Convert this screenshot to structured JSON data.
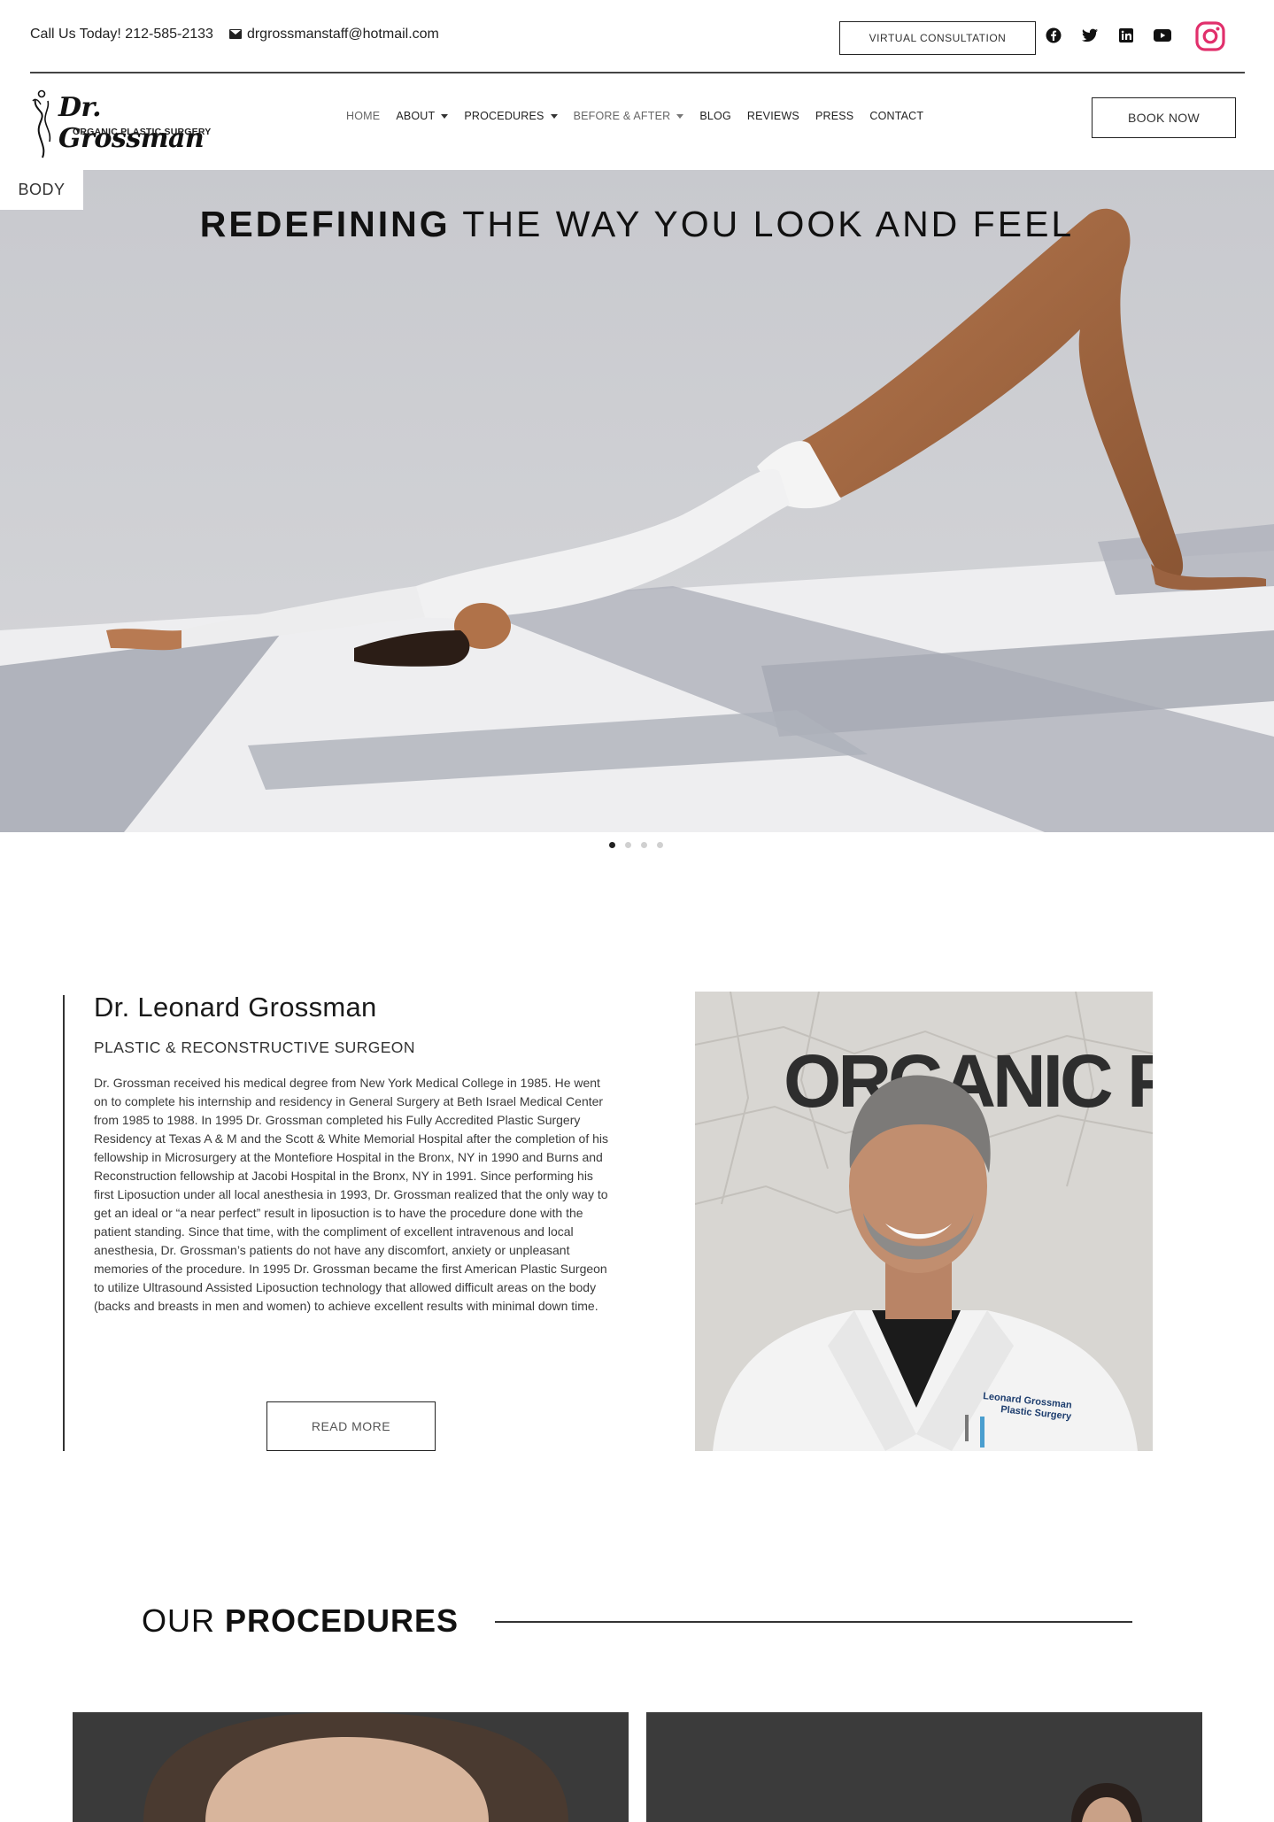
{
  "topbar": {
    "phone_text": "Call Us Today! 212-585-2133",
    "email": "drgrossmanstaff@hotmail.com",
    "virtual_consultation_label": "VIRTUAL CONSULTATION",
    "socials": [
      "facebook-icon",
      "twitter-icon",
      "linkedin-icon",
      "youtube-icon",
      "instagram-icon"
    ]
  },
  "logo": {
    "script_text": "Dr. Grossman",
    "sub_text": "ORGANIC PLASTIC SURGERY"
  },
  "nav": {
    "items": [
      {
        "label": "HOME",
        "dropdown": false
      },
      {
        "label": "ABOUT",
        "dropdown": true
      },
      {
        "label": "PROCEDURES",
        "dropdown": true
      },
      {
        "label": "BEFORE & AFTER",
        "dropdown": true
      },
      {
        "label": "BLOG",
        "dropdown": false
      },
      {
        "label": "REVIEWS",
        "dropdown": false
      },
      {
        "label": "PRESS",
        "dropdown": false
      },
      {
        "label": "CONTACT",
        "dropdown": false
      }
    ],
    "book_label": "BOOK NOW"
  },
  "hero": {
    "title_bold": "REDEFINING",
    "title_rest": "THE WAY YOU LOOK AND FEEL",
    "tag": "BODY",
    "slide_count": 4,
    "active_slide": 1
  },
  "bio": {
    "name": "Dr. Leonard Grossman",
    "role": "PLASTIC & RECONSTRUCTIVE SURGEON",
    "text": "Dr. Grossman received his medical degree from New York Medical College in 1985. He went on to complete his internship and residency in General Surgery at Beth Israel Medical Center from 1985 to 1988. In 1995 Dr. Grossman completed his Fully Accredited Plastic Surgery Residency at Texas A & M and the Scott & White Memorial Hospital after the completion of his fellowship in Microsurgery at the Montefiore Hospital in the Bronx, NY in 1990 and Burns and Reconstruction fellowship at Jacobi Hospital in the Bronx, NY in 1991. Since performing his first Liposuction under all local anesthesia in 1993, Dr. Grossman realized that the only way to get an ideal or “a near perfect” result in liposuction is to have the procedure done with the patient standing. Since that time, with the compliment of excellent intravenous and local anesthesia, Dr. Grossman’s patients do not have any discomfort, anxiety or unpleasant memories of the procedure. In 1995 Dr. Grossman became the first American Plastic Surgeon to utilize Ultrasound Assisted Liposuction technology that allowed difficult areas on the body (backs and breasts in men and women) to achieve excellent results with minimal down time.",
    "read_more_label": "READ MORE",
    "photo_wall_text": "ORGANIC PLA",
    "coat_text_line1": "Leonard Grossman",
    "coat_text_line2": "Plastic Surgery"
  },
  "procedures": {
    "title_light": "OUR",
    "title_bold": "PROCEDURES"
  },
  "colors": {
    "instagram": "#e1306c",
    "text": "#1a1a1a"
  }
}
